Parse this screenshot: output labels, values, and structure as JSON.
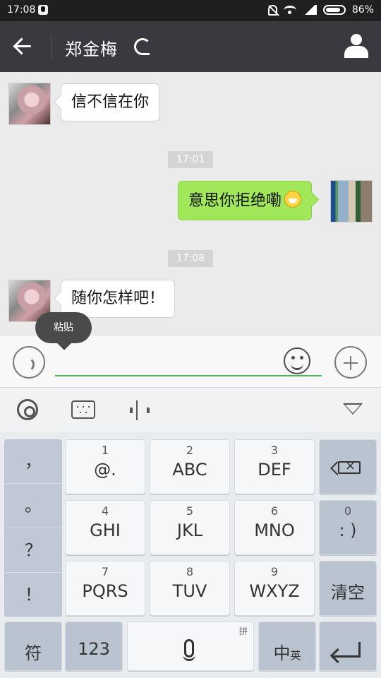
{
  "status": {
    "time": "17:08",
    "battery": "86%"
  },
  "chat": {
    "contact_name": "郑金梅",
    "messages": [
      {
        "side": "left",
        "text": "信不信在你"
      },
      {
        "side": "right",
        "text": "意思你拒绝嘞"
      },
      {
        "side": "left",
        "text": "随你怎样吧！"
      }
    ],
    "timestamps": [
      "17:01",
      "17:08"
    ]
  },
  "input": {
    "tooltip": "粘贴",
    "placeholder": ""
  },
  "keyboard": {
    "punctuation": [
      "，",
      "。",
      "？",
      "！"
    ],
    "keys": [
      {
        "num": "1",
        "label": "@."
      },
      {
        "num": "2",
        "label": "ABC"
      },
      {
        "num": "3",
        "label": "DEF"
      },
      {
        "num": "4",
        "label": "GHI"
      },
      {
        "num": "5",
        "label": "JKL"
      },
      {
        "num": "6",
        "label": "MNO"
      },
      {
        "num": "7",
        "label": "PQRS"
      },
      {
        "num": "8",
        "label": "TUV"
      },
      {
        "num": "9",
        "label": "WXYZ"
      }
    ],
    "zero": {
      "num": "0",
      "label": ": )"
    },
    "clear": "清空",
    "symbol": "符",
    "numbers": "123",
    "pinyin": "拼",
    "lang": "中",
    "lang_small": "英"
  },
  "colors": {
    "header": "#393a3f",
    "chat_bg": "#ebebeb",
    "sent_bubble": "#a0e75a",
    "input_underline": "#4bb84b"
  },
  "icons": [
    "qq-icon",
    "silent-icon",
    "wifi-icon",
    "signal-icon",
    "battery-icon",
    "back-arrow-icon",
    "ear-icon",
    "profile-icon",
    "voice-icon",
    "emoji-icon",
    "plus-icon",
    "settings-icon",
    "keyboard-icon",
    "cursor-icon",
    "collapse-icon",
    "backspace-icon",
    "mic-icon",
    "enter-icon"
  ]
}
